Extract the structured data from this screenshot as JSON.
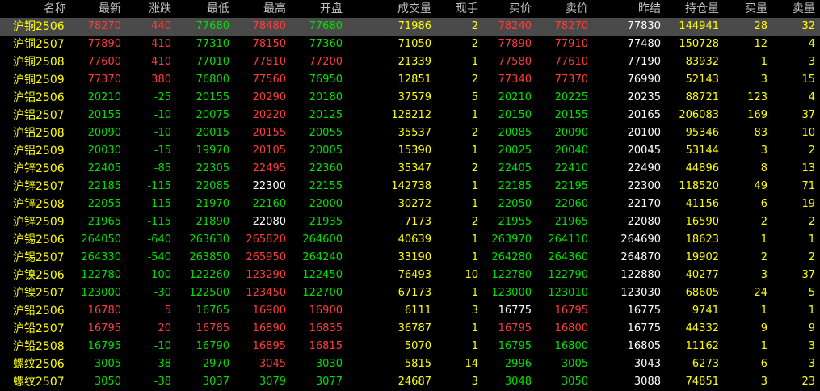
{
  "columns": [
    "名称",
    "最新",
    "涨跌",
    "最低",
    "最高",
    "开盘",
    "成交量",
    "现手",
    "买价",
    "卖价",
    "昨结",
    "持仓量",
    "买量",
    "卖量"
  ],
  "colors": {
    "up": "#ff3b3b",
    "down": "#00e000",
    "flat": "#ffffff",
    "name": "#ffff00"
  },
  "rows": [
    {
      "name": "沪铜2506",
      "latest": "78270",
      "change": "440",
      "low": "77680",
      "high": "78480",
      "open": "77680",
      "volume": "71986",
      "lastqty": "2",
      "bid": "78240",
      "ask": "78270",
      "prevsettle": "77830",
      "oi": "144941",
      "bidvol": "28",
      "askvol": "32",
      "selected": true
    },
    {
      "name": "沪铜2507",
      "latest": "77890",
      "change": "410",
      "low": "77310",
      "high": "78150",
      "open": "77360",
      "volume": "71050",
      "lastqty": "2",
      "bid": "77890",
      "ask": "77910",
      "prevsettle": "77480",
      "oi": "150728",
      "bidvol": "12",
      "askvol": "4"
    },
    {
      "name": "沪铜2508",
      "latest": "77600",
      "change": "410",
      "low": "77010",
      "high": "77810",
      "open": "77200",
      "volume": "21339",
      "lastqty": "1",
      "bid": "77580",
      "ask": "77610",
      "prevsettle": "77190",
      "oi": "83932",
      "bidvol": "1",
      "askvol": "3"
    },
    {
      "name": "沪铜2509",
      "latest": "77370",
      "change": "380",
      "low": "76800",
      "high": "77560",
      "open": "76950",
      "volume": "12851",
      "lastqty": "2",
      "bid": "77340",
      "ask": "77370",
      "prevsettle": "76990",
      "oi": "52143",
      "bidvol": "3",
      "askvol": "15"
    },
    {
      "name": "沪铝2506",
      "latest": "20210",
      "change": "-25",
      "low": "20155",
      "high": "20290",
      "open": "20180",
      "volume": "37579",
      "lastqty": "5",
      "bid": "20210",
      "ask": "20225",
      "prevsettle": "20235",
      "oi": "88721",
      "bidvol": "123",
      "askvol": "4"
    },
    {
      "name": "沪铝2507",
      "latest": "20155",
      "change": "-10",
      "low": "20075",
      "high": "20220",
      "open": "20125",
      "volume": "128212",
      "lastqty": "1",
      "bid": "20150",
      "ask": "20155",
      "prevsettle": "20165",
      "oi": "206083",
      "bidvol": "169",
      "askvol": "37"
    },
    {
      "name": "沪铝2508",
      "latest": "20090",
      "change": "-10",
      "low": "20015",
      "high": "20155",
      "open": "20055",
      "volume": "35537",
      "lastqty": "2",
      "bid": "20085",
      "ask": "20090",
      "prevsettle": "20100",
      "oi": "95346",
      "bidvol": "83",
      "askvol": "10"
    },
    {
      "name": "沪铝2509",
      "latest": "20030",
      "change": "-15",
      "low": "19970",
      "high": "20105",
      "open": "20005",
      "volume": "15390",
      "lastqty": "1",
      "bid": "20025",
      "ask": "20040",
      "prevsettle": "20045",
      "oi": "53144",
      "bidvol": "3",
      "askvol": "2"
    },
    {
      "name": "沪锌2506",
      "latest": "22405",
      "change": "-85",
      "low": "22305",
      "high": "22495",
      "open": "22360",
      "volume": "35347",
      "lastqty": "2",
      "bid": "22405",
      "ask": "22410",
      "prevsettle": "22490",
      "oi": "44896",
      "bidvol": "8",
      "askvol": "13"
    },
    {
      "name": "沪锌2507",
      "latest": "22185",
      "change": "-115",
      "low": "22085",
      "high": "22300",
      "open": "22155",
      "volume": "142738",
      "lastqty": "1",
      "bid": "22185",
      "ask": "22195",
      "prevsettle": "22300",
      "oi": "118520",
      "bidvol": "49",
      "askvol": "71"
    },
    {
      "name": "沪锌2508",
      "latest": "22055",
      "change": "-115",
      "low": "21970",
      "high": "22160",
      "open": "22000",
      "volume": "30272",
      "lastqty": "1",
      "bid": "22050",
      "ask": "22060",
      "prevsettle": "22170",
      "oi": "41156",
      "bidvol": "6",
      "askvol": "19"
    },
    {
      "name": "沪锌2509",
      "latest": "21965",
      "change": "-115",
      "low": "21890",
      "high": "22080",
      "open": "21935",
      "volume": "7173",
      "lastqty": "2",
      "bid": "21955",
      "ask": "21965",
      "prevsettle": "22080",
      "oi": "16590",
      "bidvol": "2",
      "askvol": "2"
    },
    {
      "name": "沪锡2506",
      "latest": "264050",
      "change": "-640",
      "low": "263630",
      "high": "265820",
      "open": "264600",
      "volume": "40639",
      "lastqty": "1",
      "bid": "263970",
      "ask": "264110",
      "prevsettle": "264690",
      "oi": "18623",
      "bidvol": "1",
      "askvol": "1"
    },
    {
      "name": "沪锡2507",
      "latest": "264330",
      "change": "-540",
      "low": "263850",
      "high": "265950",
      "open": "264240",
      "volume": "33190",
      "lastqty": "1",
      "bid": "264280",
      "ask": "264360",
      "prevsettle": "264870",
      "oi": "19902",
      "bidvol": "2",
      "askvol": "2"
    },
    {
      "name": "沪镍2506",
      "latest": "122780",
      "change": "-100",
      "low": "122260",
      "high": "123290",
      "open": "122450",
      "volume": "76493",
      "lastqty": "10",
      "bid": "122780",
      "ask": "122790",
      "prevsettle": "122880",
      "oi": "40277",
      "bidvol": "3",
      "askvol": "37"
    },
    {
      "name": "沪镍2507",
      "latest": "123000",
      "change": "-30",
      "low": "122500",
      "high": "123450",
      "open": "122700",
      "volume": "67173",
      "lastqty": "1",
      "bid": "123000",
      "ask": "123010",
      "prevsettle": "123030",
      "oi": "68605",
      "bidvol": "24",
      "askvol": "5"
    },
    {
      "name": "沪铅2506",
      "latest": "16780",
      "change": "5",
      "low": "16765",
      "high": "16900",
      "open": "16900",
      "volume": "6111",
      "lastqty": "3",
      "bid": "16775",
      "ask": "16795",
      "prevsettle": "16775",
      "oi": "9741",
      "bidvol": "1",
      "askvol": "1"
    },
    {
      "name": "沪铅2507",
      "latest": "16795",
      "change": "20",
      "low": "16785",
      "high": "16890",
      "open": "16835",
      "volume": "36787",
      "lastqty": "1",
      "bid": "16795",
      "ask": "16800",
      "prevsettle": "16775",
      "oi": "44332",
      "bidvol": "9",
      "askvol": "9"
    },
    {
      "name": "沪铅2508",
      "latest": "16795",
      "change": "-10",
      "low": "16790",
      "high": "16895",
      "open": "16815",
      "volume": "5070",
      "lastqty": "1",
      "bid": "16795",
      "ask": "16800",
      "prevsettle": "16805",
      "oi": "11162",
      "bidvol": "1",
      "askvol": "3"
    },
    {
      "name": "螺纹2506",
      "latest": "3005",
      "change": "-38",
      "low": "2970",
      "high": "3045",
      "open": "3030",
      "volume": "5815",
      "lastqty": "14",
      "bid": "2996",
      "ask": "3005",
      "prevsettle": "3043",
      "oi": "6273",
      "bidvol": "6",
      "askvol": "3"
    },
    {
      "name": "螺纹2507",
      "latest": "3050",
      "change": "-38",
      "low": "3037",
      "high": "3079",
      "open": "3077",
      "volume": "24687",
      "lastqty": "3",
      "bid": "3048",
      "ask": "3050",
      "prevsettle": "3088",
      "oi": "74851",
      "bidvol": "3",
      "askvol": "23"
    }
  ]
}
